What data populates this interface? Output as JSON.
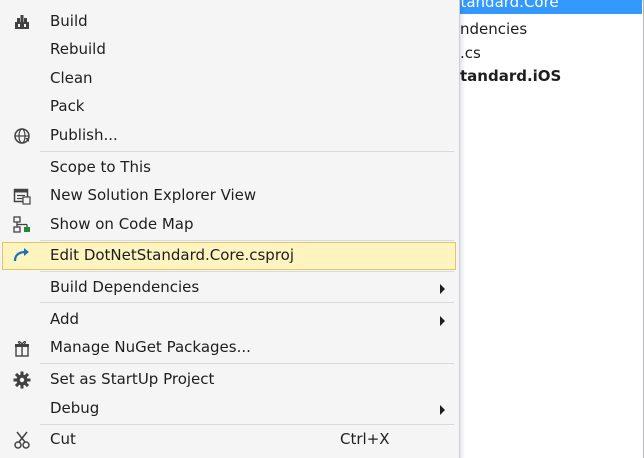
{
  "explorer": {
    "selected_item": "DotNetStandard.Core",
    "selected_item_visible": "DotNetStandard.Core",
    "rows": [
      {
        "text": "ndencies"
      },
      {
        "text": ".cs"
      },
      {
        "text": "tandard.iOS"
      }
    ]
  },
  "context_menu": {
    "items": [
      {
        "label": "Build",
        "icon": "build-icon"
      },
      {
        "label": "Rebuild"
      },
      {
        "label": "Clean"
      },
      {
        "label": "Pack"
      },
      {
        "label": "Publish...",
        "icon": "globe-icon"
      },
      {
        "label": "Scope to This"
      },
      {
        "label": "New Solution Explorer View",
        "icon": "solution-explorer-icon"
      },
      {
        "label": "Show on Code Map",
        "icon": "code-map-icon"
      },
      {
        "label": "Edit DotNetStandard.Core.csproj",
        "icon": "edit-arrow-icon",
        "highlighted": true
      },
      {
        "label": "Build Dependencies",
        "submenu": true
      },
      {
        "label": "Add",
        "submenu": true
      },
      {
        "label": "Manage NuGet Packages...",
        "icon": "nuget-gift-icon"
      },
      {
        "label": "Set as StartUp Project",
        "icon": "gear-icon"
      },
      {
        "label": "Debug",
        "submenu": true
      },
      {
        "label": "Cut",
        "icon": "scissors-icon",
        "shortcut": "Ctrl+X"
      }
    ]
  },
  "colors": {
    "selection": "#3399ff",
    "highlight_background": "#fdf4bf",
    "highlight_border": "#e5c365",
    "menu_background": "#f5f5f5"
  }
}
